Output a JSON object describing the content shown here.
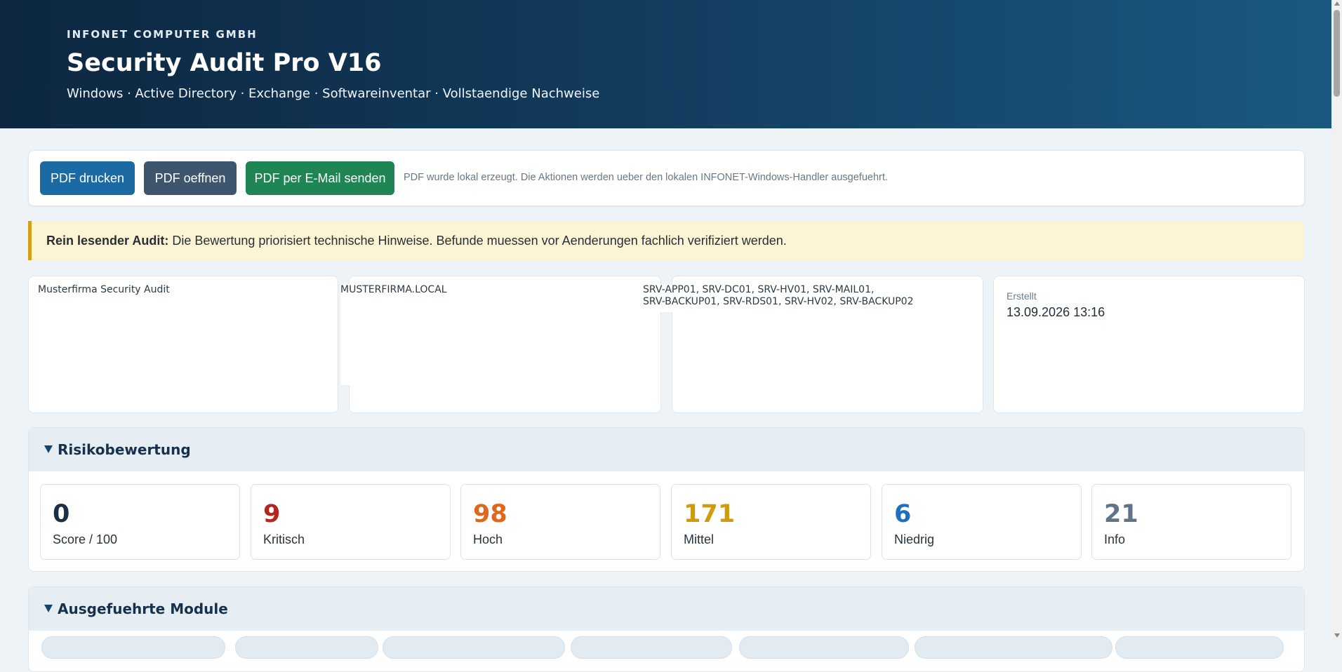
{
  "header": {
    "company": "INFONET COMPUTER GMBH",
    "title": "Security Audit Pro V16",
    "subtitle": "Windows · Active Directory · Exchange · Softwareinventar · Vollstaendige Nachweise"
  },
  "toolbar": {
    "print_label": "PDF drucken",
    "open_label": "PDF oeffnen",
    "mail_label": "PDF per E-Mail senden",
    "note": "PDF wurde lokal erzeugt. Die Aktionen werden ueber den lokalen INFONET-Windows-Handler ausgefuehrt."
  },
  "notice": {
    "bold": "Rein lesender Audit:",
    "text": " Die Bewertung priorisiert technische Hinweise. Befunde muessen vor Aenderungen fachlich verifiziert werden."
  },
  "info": {
    "audit_name": "Musterfirma Security Audit",
    "domain": "MUSTERFIRMA.LOCAL",
    "servers_line1": "SRV-APP01, SRV-DC01, SRV-HV01, SRV-MAIL01,",
    "servers_line2": "SRV-BACKUP01, SRV-RDS01, SRV-HV02, SRV-BACKUP02",
    "created_label": "Erstellt",
    "created_value": "13.09.2026 13:16"
  },
  "risk": {
    "title": "Risikobewertung",
    "kpis": [
      {
        "value": "0",
        "label": "Score / 100",
        "color": "#1b2f45"
      },
      {
        "value": "9",
        "label": "Kritisch",
        "color": "#b3261e"
      },
      {
        "value": "98",
        "label": "Hoch",
        "color": "#e0661b"
      },
      {
        "value": "171",
        "label": "Mittel",
        "color": "#d19a0c"
      },
      {
        "value": "6",
        "label": "Niedrig",
        "color": "#1f6fbf"
      },
      {
        "value": "21",
        "label": "Info",
        "color": "#5f7389"
      }
    ]
  },
  "modules": {
    "title": "Ausgefuehrte Module"
  }
}
